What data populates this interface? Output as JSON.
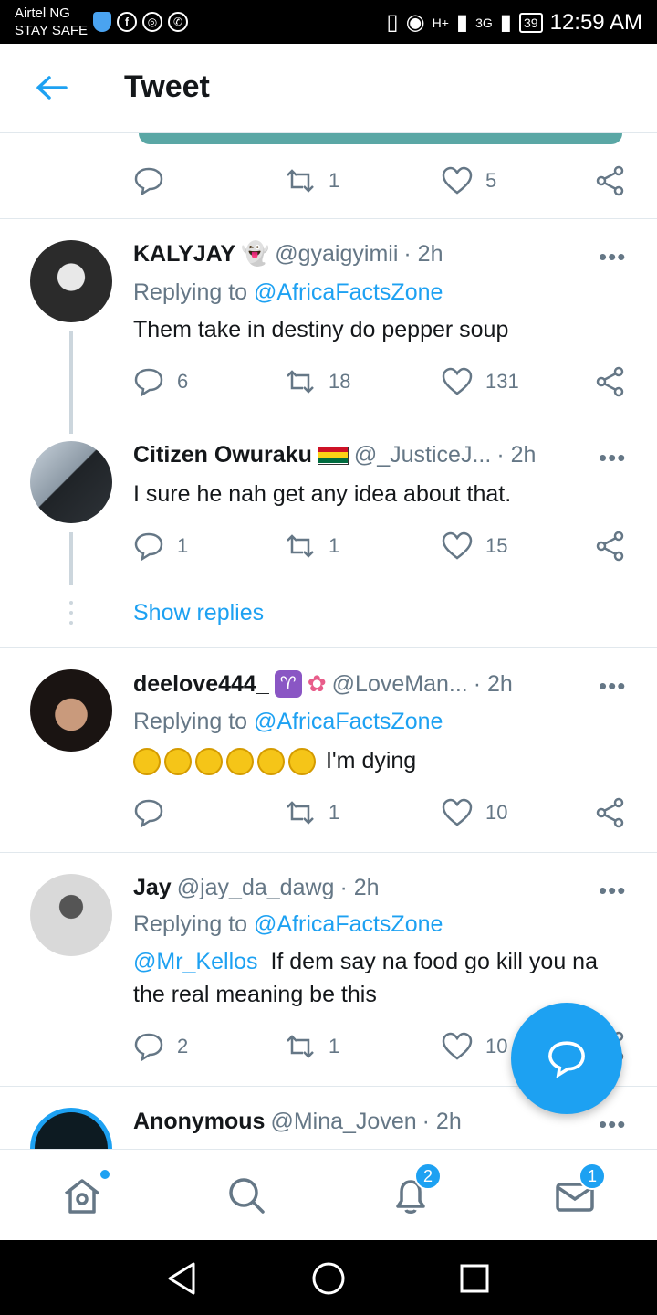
{
  "status_bar": {
    "carrier_line1": "Airtel NG",
    "carrier_line2": "STAY SAFE",
    "battery": "39",
    "time": "12:59 AM",
    "network1": "H+",
    "network2": "3G"
  },
  "header": {
    "title": "Tweet"
  },
  "top_actions": {
    "retweets": "1",
    "likes": "5"
  },
  "tweets": [
    {
      "name": "KALYJAY",
      "handle": "@gyaigyimii",
      "time": "· 2h",
      "replying_prefix": "Replying to",
      "replying_to": "@AfricaFactsZone",
      "text": "Them take in destiny do pepper soup",
      "replies": "6",
      "retweets": "18",
      "likes": "131"
    },
    {
      "name": "Citizen Owuraku",
      "handle": "@_JusticeJ...",
      "time": "· 2h",
      "text": "I sure he nah get any idea about that.",
      "replies": "1",
      "retweets": "1",
      "likes": "15"
    },
    {
      "name": "deelove444_",
      "handle": "@LoveMan...",
      "time": "· 2h",
      "replying_prefix": "Replying to",
      "replying_to": "@AfricaFactsZone",
      "text": "I'm dying",
      "retweets": "1",
      "likes": "10"
    },
    {
      "name": "Jay",
      "handle": "@jay_da_dawg",
      "time": "· 2h",
      "replying_prefix": "Replying to",
      "replying_to": "@AfricaFactsZone",
      "mention": "@Mr_Kellos",
      "text": "If dem say na food go kill you na the real meaning be this",
      "replies": "2",
      "retweets": "1",
      "likes": "10"
    },
    {
      "name": "Anonymous",
      "handle": "@Mina_Joven",
      "time": "· 2h"
    }
  ],
  "show_replies": "Show replies",
  "more_label": "•••",
  "bottom_nav": {
    "notifications_badge": "2",
    "messages_badge": "1"
  },
  "colors": {
    "accent": "#1da1f2",
    "muted": "#657786",
    "divider": "#e1e8ed"
  }
}
